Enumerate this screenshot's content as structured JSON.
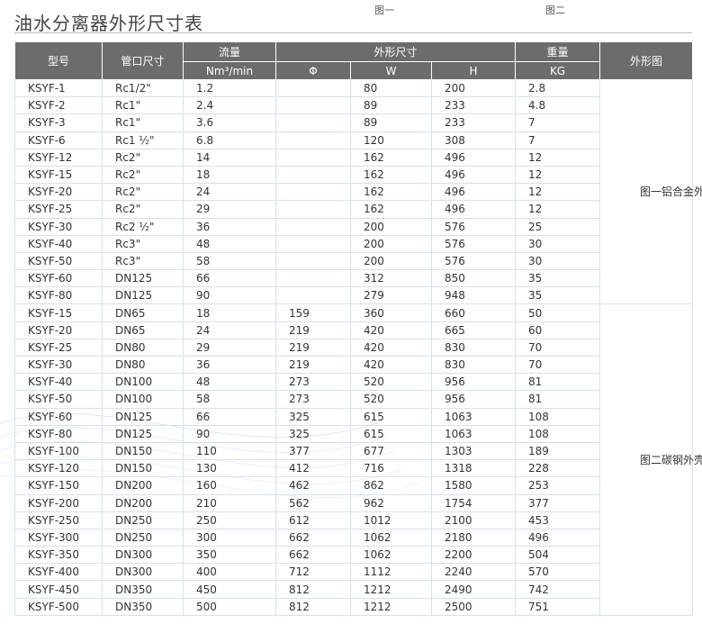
{
  "title": "油水分离器外形尺寸表",
  "figure_labels": [
    "图一",
    "图二"
  ],
  "headers": {
    "model": "型号",
    "port": "管口尺寸",
    "flow": "流量",
    "flow_unit": "Nm³/min",
    "dims": "外形尺寸",
    "phi": "Φ",
    "w": "W",
    "h": "H",
    "weight": "重量",
    "weight_unit": "KG",
    "shape": "外形图"
  },
  "shape_groups": [
    {
      "text": "图一铝合金外壳"
    },
    {
      "text": "图二碳钢外壳"
    }
  ],
  "rows": [
    {
      "model": "KSYF-1",
      "port": "Rc1/2\"",
      "flow": "1.2",
      "phi": "",
      "w": "80",
      "h": "200",
      "kg": "2.8"
    },
    {
      "model": "KSYF-2",
      "port": "Rc1\"",
      "flow": "2.4",
      "phi": "",
      "w": "89",
      "h": "233",
      "kg": "4.8"
    },
    {
      "model": "KSYF-3",
      "port": "Rc1\"",
      "flow": "3.6",
      "phi": "",
      "w": "89",
      "h": "233",
      "kg": "7"
    },
    {
      "model": "KSYF-6",
      "port": "Rc1 ½\"",
      "flow": "6.8",
      "phi": "",
      "w": "120",
      "h": "308",
      "kg": "7"
    },
    {
      "model": "KSYF-12",
      "port": "Rc2\"",
      "flow": "14",
      "phi": "",
      "w": "162",
      "h": "496",
      "kg": "12"
    },
    {
      "model": "KSYF-15",
      "port": "Rc2\"",
      "flow": "18",
      "phi": "",
      "w": "162",
      "h": "496",
      "kg": "12"
    },
    {
      "model": "KSYF-20",
      "port": "Rc2\"",
      "flow": "24",
      "phi": "",
      "w": "162",
      "h": "496",
      "kg": "12"
    },
    {
      "model": "KSYF-25",
      "port": "Rc2\"",
      "flow": "29",
      "phi": "",
      "w": "162",
      "h": "496",
      "kg": "12"
    },
    {
      "model": "KSYF-30",
      "port": "Rc2 ½\"",
      "flow": "36",
      "phi": "",
      "w": "200",
      "h": "576",
      "kg": "25"
    },
    {
      "model": "KSYF-40",
      "port": "Rc3\"",
      "flow": "48",
      "phi": "",
      "w": "200",
      "h": "576",
      "kg": "30"
    },
    {
      "model": "KSYF-50",
      "port": "Rc3\"",
      "flow": "58",
      "phi": "",
      "w": "200",
      "h": "576",
      "kg": "30"
    },
    {
      "model": "KSYF-60",
      "port": "DN125",
      "flow": "66",
      "phi": "",
      "w": "312",
      "h": "850",
      "kg": "35"
    },
    {
      "model": "KSYF-80",
      "port": "DN125",
      "flow": "90",
      "phi": "",
      "w": "279",
      "h": "948",
      "kg": "35"
    },
    {
      "model": "KSYF-15",
      "port": "DN65",
      "flow": "18",
      "phi": "159",
      "w": "360",
      "h": "660",
      "kg": "50"
    },
    {
      "model": "KSYF-20",
      "port": "DN65",
      "flow": "24",
      "phi": "219",
      "w": "420",
      "h": "665",
      "kg": "60"
    },
    {
      "model": "KSYF-25",
      "port": "DN80",
      "flow": "29",
      "phi": "219",
      "w": "420",
      "h": "830",
      "kg": "70"
    },
    {
      "model": "KSYF-30",
      "port": "DN80",
      "flow": "36",
      "phi": "219",
      "w": "420",
      "h": "830",
      "kg": "70"
    },
    {
      "model": "KSYF-40",
      "port": "DN100",
      "flow": "48",
      "phi": "273",
      "w": "520",
      "h": "956",
      "kg": "81"
    },
    {
      "model": "KSYF-50",
      "port": "DN100",
      "flow": "58",
      "phi": "273",
      "w": "520",
      "h": "956",
      "kg": "81"
    },
    {
      "model": "KSYF-60",
      "port": "DN125",
      "flow": "66",
      "phi": "325",
      "w": "615",
      "h": "1063",
      "kg": "108"
    },
    {
      "model": "KSYF-80",
      "port": "DN125",
      "flow": "90",
      "phi": "325",
      "w": "615",
      "h": "1063",
      "kg": "108"
    },
    {
      "model": "KSYF-100",
      "port": "DN150",
      "flow": "110",
      "phi": "377",
      "w": "677",
      "h": "1303",
      "kg": "189"
    },
    {
      "model": "KSYF-120",
      "port": "DN150",
      "flow": "130",
      "phi": "412",
      "w": "716",
      "h": "1318",
      "kg": "228"
    },
    {
      "model": "KSYF-150",
      "port": "DN200",
      "flow": "160",
      "phi": "462",
      "w": "862",
      "h": "1580",
      "kg": "253"
    },
    {
      "model": "KSYF-200",
      "port": "DN200",
      "flow": "210",
      "phi": "562",
      "w": "962",
      "h": "1754",
      "kg": "377"
    },
    {
      "model": "KSYF-250",
      "port": "DN250",
      "flow": "250",
      "phi": "612",
      "w": "1012",
      "h": "2100",
      "kg": "453"
    },
    {
      "model": "KSYF-300",
      "port": "DN250",
      "flow": "300",
      "phi": "662",
      "w": "1062",
      "h": "2180",
      "kg": "496"
    },
    {
      "model": "KSYF-350",
      "port": "DN300",
      "flow": "350",
      "phi": "662",
      "w": "1062",
      "h": "2200",
      "kg": "504"
    },
    {
      "model": "KSYF-400",
      "port": "DN300",
      "flow": "400",
      "phi": "712",
      "w": "1112",
      "h": "2240",
      "kg": "570"
    },
    {
      "model": "KSYF-450",
      "port": "DN350",
      "flow": "450",
      "phi": "812",
      "w": "1212",
      "h": "2490",
      "kg": "742"
    },
    {
      "model": "KSYF-500",
      "port": "DN350",
      "flow": "500",
      "phi": "812",
      "w": "1212",
      "h": "2500",
      "kg": "751"
    }
  ]
}
